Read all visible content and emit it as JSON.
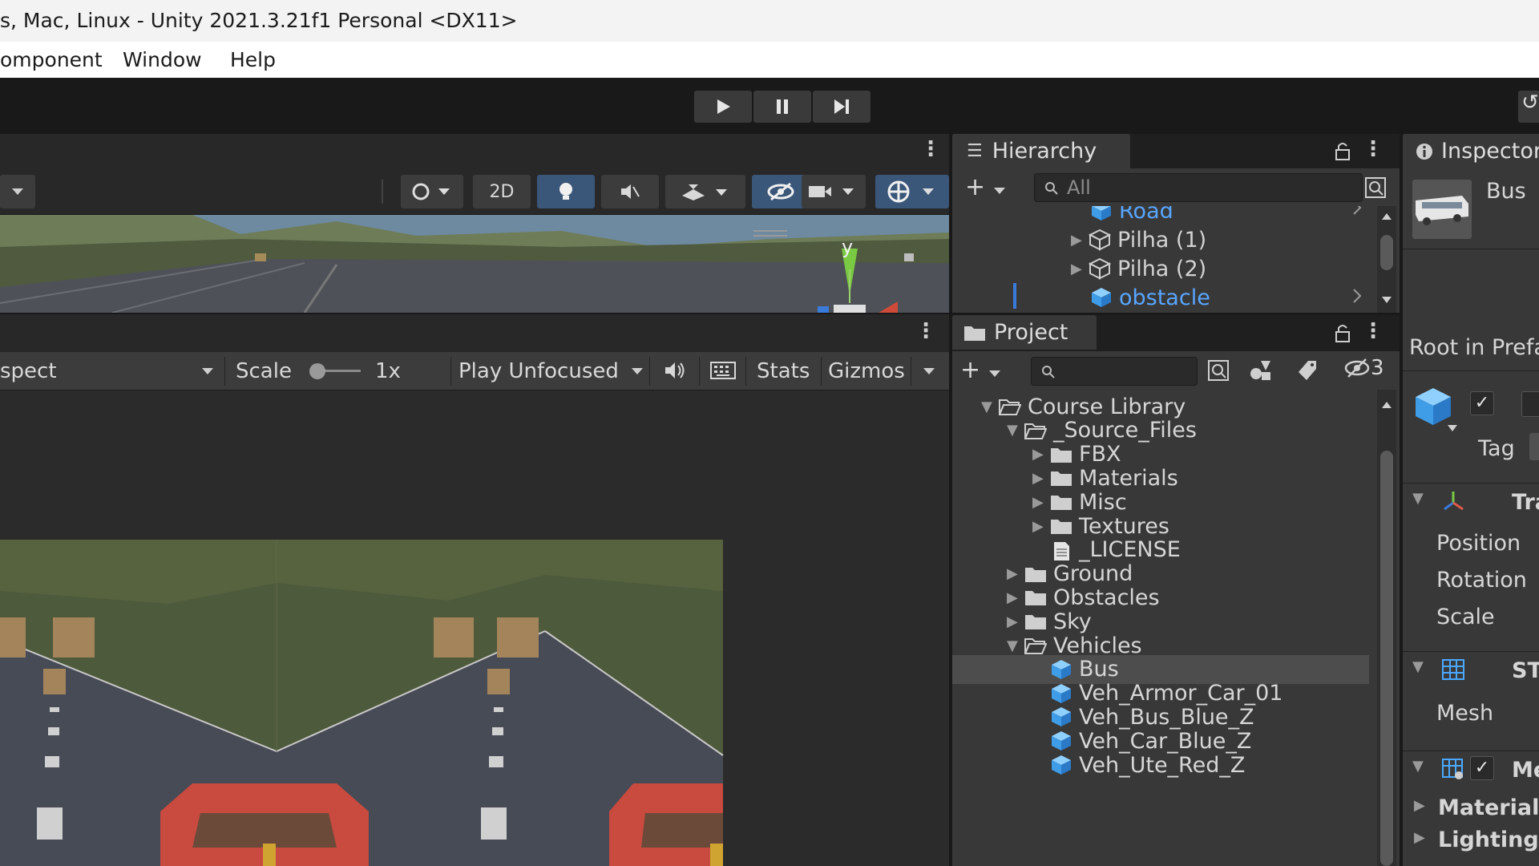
{
  "window": {
    "title": "s, Mac, Linux - Unity 2021.3.21f1 Personal <DX11>"
  },
  "menu": {
    "items": [
      "omponent",
      "Window",
      "Help"
    ]
  },
  "toolbar": {
    "play_icon": "play-icon",
    "pause_icon": "pause-icon",
    "step_icon": "step-icon"
  },
  "scene_tools": {
    "twod_label": "2D"
  },
  "scene_view": {
    "axis_label": "y"
  },
  "game_toolbar": {
    "aspect_label": "spect",
    "scale_label": "Scale",
    "scale_value": "1x",
    "play_mode_label": "Play Unfocused",
    "stats_label": "Stats",
    "gizmos_label": "Gizmos"
  },
  "hierarchy": {
    "tab_label": "Hierarchy",
    "search_placeholder": "All",
    "items": [
      {
        "label": "Road",
        "type": "prefab",
        "selected": false
      },
      {
        "label": "Pilha (1)",
        "type": "object",
        "selected": false
      },
      {
        "label": "Pilha (2)",
        "type": "object",
        "selected": false
      },
      {
        "label": "obstacle",
        "type": "prefab",
        "selected": false
      }
    ]
  },
  "project": {
    "tab_label": "Project",
    "search_placeholder": "",
    "hidden_count": "3",
    "tree": [
      {
        "label": "Course Library",
        "type": "folder-open"
      },
      {
        "label": "_Source_Files",
        "type": "folder-open"
      },
      {
        "label": "FBX",
        "type": "folder"
      },
      {
        "label": "Materials",
        "type": "folder"
      },
      {
        "label": "Misc",
        "type": "folder"
      },
      {
        "label": "Textures",
        "type": "folder"
      },
      {
        "label": "_LICENSE",
        "type": "file"
      },
      {
        "label": "Ground",
        "type": "folder"
      },
      {
        "label": "Obstacles",
        "type": "folder"
      },
      {
        "label": "Sky",
        "type": "folder"
      },
      {
        "label": "Vehicles",
        "type": "folder-open"
      },
      {
        "label": "Bus",
        "type": "prefab",
        "selected": true
      },
      {
        "label": "Veh_Armor_Car_01",
        "type": "prefab"
      },
      {
        "label": "Veh_Bus_Blue_Z",
        "type": "prefab"
      },
      {
        "label": "Veh_Car_Blue_Z",
        "type": "prefab"
      },
      {
        "label": "Veh_Ute_Red_Z",
        "type": "prefab"
      }
    ]
  },
  "inspector": {
    "tab_label": "Inspector",
    "object_name": "Bus",
    "root_label": "Root in Prefa",
    "tag_label": "Tag",
    "transform_label": "Tra",
    "position_label": "Position",
    "rotation_label": "Rotation",
    "scale_label": "Scale",
    "mesh_filter_label": "ST",
    "mesh_label": "Mesh",
    "mesh_renderer_label": "Me",
    "materials_label": "Materials",
    "lighting_label": "Lighting"
  },
  "colors": {
    "accent_blue": "#3a5679",
    "prefab_blue": "#4aa8ff",
    "selected_row": "#4d4d4d",
    "panel": "#383838"
  }
}
